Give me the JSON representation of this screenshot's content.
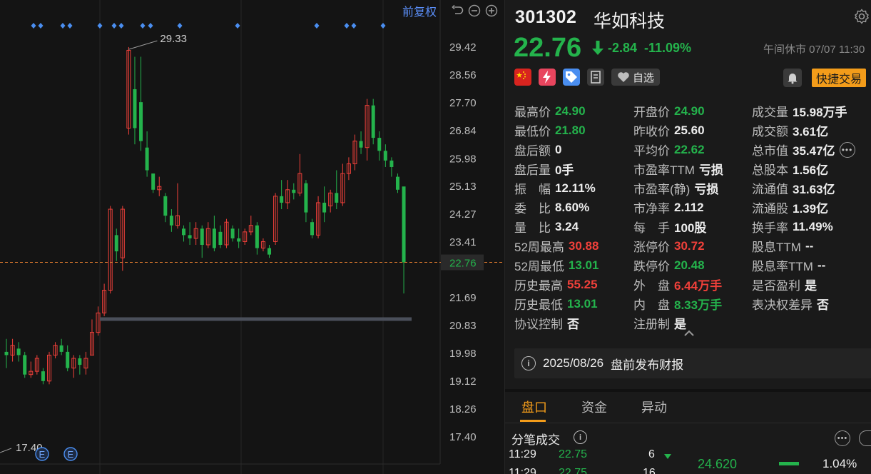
{
  "chart_toolbar": {
    "adjust_label": "前复权"
  },
  "chart_data": {
    "type": "candlestick",
    "y_ticks": [
      "29.42",
      "28.56",
      "27.70",
      "26.84",
      "25.98",
      "25.13",
      "24.27",
      "23.41",
      "22.76",
      "21.69",
      "20.83",
      "19.98",
      "19.12",
      "18.26",
      "17.40"
    ],
    "ylim": [
      17.4,
      29.42
    ],
    "last_price": "22.76",
    "high_annotation": "29.33",
    "low_annotation": "17.40",
    "grid": true,
    "candles": [
      {
        "o": 20.0,
        "c": 19.9,
        "h": 20.4,
        "l": 19.5
      },
      {
        "o": 19.9,
        "c": 20.2,
        "h": 20.4,
        "l": 19.7
      },
      {
        "o": 20.1,
        "c": 19.9,
        "h": 20.3,
        "l": 19.7
      },
      {
        "o": 19.9,
        "c": 19.3,
        "h": 20.0,
        "l": 19.2
      },
      {
        "o": 19.3,
        "c": 19.4,
        "h": 19.7,
        "l": 19.2
      },
      {
        "o": 19.4,
        "c": 19.8,
        "h": 19.9,
        "l": 19.3
      },
      {
        "o": 19.4,
        "c": 19.1,
        "h": 19.5,
        "l": 19.0
      },
      {
        "o": 19.1,
        "c": 19.9,
        "h": 20.0,
        "l": 19.0
      },
      {
        "o": 19.9,
        "c": 20.2,
        "h": 20.3,
        "l": 19.8
      },
      {
        "o": 20.2,
        "c": 20.0,
        "h": 20.4,
        "l": 19.9
      },
      {
        "o": 20.0,
        "c": 19.5,
        "h": 20.2,
        "l": 19.4
      },
      {
        "o": 19.5,
        "c": 19.8,
        "h": 19.9,
        "l": 19.2
      },
      {
        "o": 19.8,
        "c": 19.6,
        "h": 19.9,
        "l": 19.3
      },
      {
        "o": 19.5,
        "c": 19.8,
        "h": 20.0,
        "l": 19.3
      },
      {
        "o": 19.9,
        "c": 20.6,
        "h": 21.0,
        "l": 19.9
      },
      {
        "o": 20.6,
        "c": 21.2,
        "h": 21.4,
        "l": 20.5
      },
      {
        "o": 21.2,
        "c": 21.9,
        "h": 22.1,
        "l": 21.1
      },
      {
        "o": 21.9,
        "c": 24.4,
        "h": 24.5,
        "l": 21.8
      },
      {
        "o": 23.6,
        "c": 23.1,
        "h": 23.8,
        "l": 22.8
      },
      {
        "o": 22.9,
        "c": 24.4,
        "h": 24.5,
        "l": 22.5
      },
      {
        "o": 26.9,
        "c": 29.3,
        "h": 29.4,
        "l": 26.7
      },
      {
        "o": 28.1,
        "c": 26.9,
        "h": 29.1,
        "l": 26.4
      },
      {
        "o": 27.7,
        "c": 26.5,
        "h": 29.1,
        "l": 26.2
      },
      {
        "o": 26.3,
        "c": 25.6,
        "h": 26.8,
        "l": 25.4
      },
      {
        "o": 25.5,
        "c": 25.0,
        "h": 25.5,
        "l": 24.9
      },
      {
        "o": 25.0,
        "c": 25.1,
        "h": 25.4,
        "l": 24.8
      },
      {
        "o": 24.8,
        "c": 24.2,
        "h": 24.9,
        "l": 24.0
      },
      {
        "o": 24.2,
        "c": 23.9,
        "h": 24.4,
        "l": 23.7
      },
      {
        "o": 23.9,
        "c": 24.2,
        "h": 25.2,
        "l": 23.8
      },
      {
        "o": 23.8,
        "c": 23.6,
        "h": 23.9,
        "l": 23.4
      },
      {
        "o": 23.6,
        "c": 23.5,
        "h": 24.0,
        "l": 23.3
      },
      {
        "o": 23.5,
        "c": 23.8,
        "h": 24.0,
        "l": 23.3
      },
      {
        "o": 23.8,
        "c": 23.3,
        "h": 23.9,
        "l": 22.9
      },
      {
        "o": 23.3,
        "c": 23.8,
        "h": 24.0,
        "l": 23.2
      },
      {
        "o": 23.8,
        "c": 23.2,
        "h": 24.2,
        "l": 23.1
      },
      {
        "o": 23.7,
        "c": 23.3,
        "h": 23.9,
        "l": 23.2
      },
      {
        "o": 23.3,
        "c": 24.0,
        "h": 24.1,
        "l": 23.2
      },
      {
        "o": 23.8,
        "c": 23.5,
        "h": 23.9,
        "l": 23.4
      },
      {
        "o": 23.5,
        "c": 23.4,
        "h": 23.8,
        "l": 23.2
      },
      {
        "o": 23.4,
        "c": 23.7,
        "h": 23.8,
        "l": 23.3
      },
      {
        "o": 23.7,
        "c": 23.9,
        "h": 24.2,
        "l": 23.6
      },
      {
        "o": 23.9,
        "c": 23.2,
        "h": 24.0,
        "l": 23.0
      },
      {
        "o": 23.2,
        "c": 23.4,
        "h": 23.5,
        "l": 23.1
      },
      {
        "o": 23.2,
        "c": 23.0,
        "h": 23.3,
        "l": 22.9
      },
      {
        "o": 23.4,
        "c": 24.8,
        "h": 24.9,
        "l": 23.3
      },
      {
        "o": 24.8,
        "c": 24.6,
        "h": 25.3,
        "l": 24.4
      },
      {
        "o": 24.6,
        "c": 25.0,
        "h": 25.3,
        "l": 24.4
      },
      {
        "o": 25.0,
        "c": 24.9,
        "h": 25.2,
        "l": 24.7
      },
      {
        "o": 24.9,
        "c": 25.5,
        "h": 26.1,
        "l": 24.8
      },
      {
        "o": 25.2,
        "c": 24.3,
        "h": 25.3,
        "l": 24.0
      },
      {
        "o": 24.0,
        "c": 23.6,
        "h": 24.1,
        "l": 23.5
      },
      {
        "o": 23.6,
        "c": 24.6,
        "h": 24.8,
        "l": 23.5
      },
      {
        "o": 24.6,
        "c": 24.3,
        "h": 25.1,
        "l": 24.0
      },
      {
        "o": 24.5,
        "c": 24.9,
        "h": 25.0,
        "l": 24.3
      },
      {
        "o": 24.9,
        "c": 24.6,
        "h": 25.6,
        "l": 24.4
      },
      {
        "o": 24.6,
        "c": 25.5,
        "h": 25.8,
        "l": 24.5
      },
      {
        "o": 25.5,
        "c": 25.8,
        "h": 26.0,
        "l": 25.3
      },
      {
        "o": 25.8,
        "c": 26.5,
        "h": 26.7,
        "l": 25.6
      },
      {
        "o": 26.5,
        "c": 26.3,
        "h": 26.8,
        "l": 26.1
      },
      {
        "o": 26.3,
        "c": 27.6,
        "h": 27.8,
        "l": 25.9
      },
      {
        "o": 27.6,
        "c": 26.6,
        "h": 27.8,
        "l": 26.4
      },
      {
        "o": 26.6,
        "c": 26.2,
        "h": 26.8,
        "l": 25.9
      },
      {
        "o": 26.2,
        "c": 25.9,
        "h": 26.4,
        "l": 25.7
      },
      {
        "o": 25.9,
        "c": 25.7,
        "h": 26.0,
        "l": 25.4
      },
      {
        "o": 25.4,
        "c": 25.0,
        "h": 25.5,
        "l": 24.9
      },
      {
        "o": 25.1,
        "c": 22.76,
        "h": 25.0,
        "l": 21.8
      }
    ],
    "support_line": 21.0,
    "signal_markers": "diamond"
  },
  "header": {
    "code": "301302",
    "name": "华如科技",
    "price": "22.76",
    "change": "-2.84",
    "change_pct": "-11.09%",
    "status_time": "午间休市 07/07 11:30"
  },
  "actions": {
    "watchlist": "自选",
    "quick_trade": "快捷交易"
  },
  "stats": {
    "col1": [
      {
        "label": "最高价",
        "value": "24.90",
        "color": "green"
      },
      {
        "label": "最低价",
        "value": "21.80",
        "color": "green"
      },
      {
        "label": "盘后额",
        "value": "0",
        "color": "white"
      },
      {
        "label": "盘后量",
        "value": "0手",
        "color": "white"
      },
      {
        "label": "振　幅",
        "value": "12.11%",
        "color": "white"
      },
      {
        "label": "委　比",
        "value": "8.60%",
        "color": "white"
      },
      {
        "label": "量　比",
        "value": "3.24",
        "color": "white"
      },
      {
        "label": "52周最高",
        "value": "30.88",
        "color": "red"
      },
      {
        "label": "52周最低",
        "value": "13.01",
        "color": "green"
      },
      {
        "label": "历史最高",
        "value": "55.25",
        "color": "red"
      },
      {
        "label": "历史最低",
        "value": "13.01",
        "color": "green"
      },
      {
        "label": "协议控制",
        "value": "否",
        "color": "white"
      }
    ],
    "col2": [
      {
        "label": "开盘价",
        "value": "24.90",
        "color": "green"
      },
      {
        "label": "昨收价",
        "value": "25.60",
        "color": "white"
      },
      {
        "label": "平均价",
        "value": "22.62",
        "color": "green"
      },
      {
        "label": "市盈率TTM",
        "value": "亏损",
        "color": "white"
      },
      {
        "label": "市盈率(静)",
        "value": "亏损",
        "color": "white"
      },
      {
        "label": "市净率",
        "value": "2.112",
        "color": "white"
      },
      {
        "label": "每　手",
        "value": "100股",
        "color": "white"
      },
      {
        "label": "涨停价",
        "value": "30.72",
        "color": "red"
      },
      {
        "label": "跌停价",
        "value": "20.48",
        "color": "green"
      },
      {
        "label": "外　盘",
        "value": "6.44万手",
        "color": "red"
      },
      {
        "label": "内　盘",
        "value": "8.33万手",
        "color": "green"
      },
      {
        "label": "注册制",
        "value": "是",
        "color": "white"
      }
    ],
    "col3": [
      {
        "label": "成交量",
        "value": "15.98万手",
        "color": "white"
      },
      {
        "label": "成交额",
        "value": "3.61亿",
        "color": "white"
      },
      {
        "label": "总市值",
        "value": "35.47亿",
        "color": "white"
      },
      {
        "label": "总股本",
        "value": "1.56亿",
        "color": "white"
      },
      {
        "label": "流通值",
        "value": "31.63亿",
        "color": "white"
      },
      {
        "label": "流通股",
        "value": "1.39亿",
        "color": "white"
      },
      {
        "label": "换手率",
        "value": "11.49%",
        "color": "white"
      },
      {
        "label": "股息TTM",
        "value": "--",
        "color": "white"
      },
      {
        "label": "股息率TTM",
        "value": "--",
        "color": "white"
      },
      {
        "label": "是否盈利",
        "value": "是",
        "color": "white"
      },
      {
        "label": "表决权差异",
        "value": "否",
        "color": "white"
      }
    ]
  },
  "report": {
    "date": "2025/08/26",
    "text": "盘前发布财报"
  },
  "tabs": [
    "盘口",
    "资金",
    "异动"
  ],
  "trades": {
    "title": "分笔成交",
    "rows": [
      {
        "time": "11:29",
        "price": "22.75",
        "vol": "6"
      },
      {
        "time": "11:29",
        "price": "22.75",
        "vol": "16"
      }
    ],
    "level_price": "24.620",
    "level_pct": "1.04%"
  },
  "colors": {
    "up": "#f0403a",
    "down": "#24b34c",
    "accent": "#f39c1a",
    "link": "#5b8ff9"
  }
}
